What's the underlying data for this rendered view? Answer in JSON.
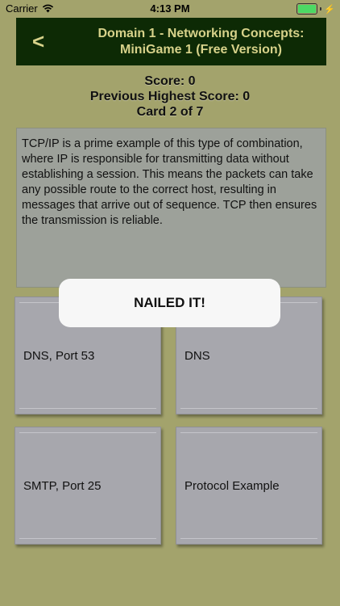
{
  "status_bar": {
    "carrier": "Carrier",
    "time": "4:13 PM",
    "wifi_icon": "wifi-icon",
    "battery_icon": "battery-icon"
  },
  "header": {
    "back_label": "<",
    "title_line1": "Domain 1 - Networking Concepts:",
    "title_line2": "MiniGame 1 (Free Version)"
  },
  "score": {
    "score_text": "Score: 0",
    "previous_highest_text": "Previous Highest Score: 0",
    "card_text": "Card 2 of 7"
  },
  "question": {
    "text": "TCP/IP is a prime example of this type of combination, where IP is responsible for transmitting data without establishing a session. This means the packets can take any possible route to the correct host, resulting in messages that arrive out of sequence. TCP then ensures the transmission is reliable."
  },
  "answers": [
    {
      "label": "DNS, Port 53"
    },
    {
      "label": "DNS"
    },
    {
      "label": "SMTP, Port 25"
    },
    {
      "label": "Protocol Example"
    }
  ],
  "toast": {
    "text": "NAILED IT!"
  },
  "colors": {
    "background": "#a3a36c",
    "header_bg": "#0d2a05",
    "header_text": "#d7d28a"
  }
}
